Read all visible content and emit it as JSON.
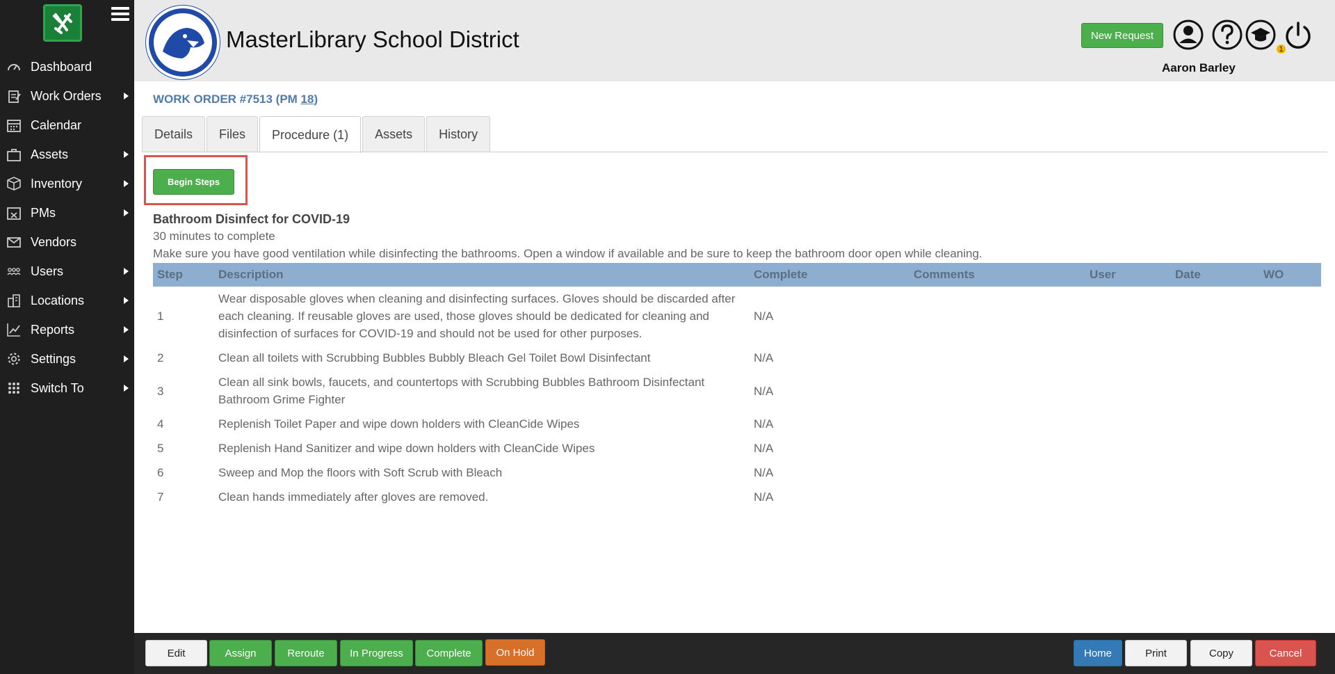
{
  "sidebar": {
    "items": [
      {
        "label": "Dashboard",
        "icon": "speedometer-icon",
        "has_arrow": false
      },
      {
        "label": "Work Orders",
        "icon": "clipboard-icon",
        "has_arrow": true
      },
      {
        "label": "Calendar",
        "icon": "calendar-icon",
        "has_arrow": false
      },
      {
        "label": "Assets",
        "icon": "briefcase-icon",
        "has_arrow": true
      },
      {
        "label": "Inventory",
        "icon": "box-icon",
        "has_arrow": true
      },
      {
        "label": "PMs",
        "icon": "tools-calendar-icon",
        "has_arrow": true
      },
      {
        "label": "Vendors",
        "icon": "envelope-icon",
        "has_arrow": false
      },
      {
        "label": "Users",
        "icon": "users-icon",
        "has_arrow": true
      },
      {
        "label": "Locations",
        "icon": "building-icon",
        "has_arrow": true
      },
      {
        "label": "Reports",
        "icon": "chart-line-icon",
        "has_arrow": true
      },
      {
        "label": "Settings",
        "icon": "gear-icon",
        "has_arrow": true
      },
      {
        "label": "Switch To",
        "icon": "grid-icon",
        "has_arrow": true
      }
    ]
  },
  "header": {
    "district_name": "MasterLibrary School District",
    "new_request_label": "New Request",
    "user_name": "Aaron Barley",
    "notification_count": "1"
  },
  "work_order": {
    "title_prefix": "WORK ORDER #7513 (PM ",
    "pm_number": "18",
    "title_suffix": ")"
  },
  "tabs": [
    {
      "label": "Details",
      "active": false
    },
    {
      "label": "Files",
      "active": false
    },
    {
      "label": "Procedure (1)",
      "active": true
    },
    {
      "label": "Assets",
      "active": false
    },
    {
      "label": "History",
      "active": false
    }
  ],
  "procedure": {
    "begin_steps_label": "Begin Steps",
    "title": "Bathroom Disinfect for COVID-19",
    "duration": "30 minutes to complete",
    "description": "Make sure you have good ventilation while disinfecting the bathrooms. Open a window if available and be sure to keep the bathroom door open while cleaning.",
    "columns": [
      "Step",
      "Description",
      "Complete",
      "Comments",
      "User",
      "Date",
      "WO"
    ],
    "steps": [
      {
        "step": "1",
        "description": "Wear disposable gloves when cleaning and disinfecting surfaces. Gloves should be discarded after each cleaning. If reusable gloves are used, those gloves should be dedicated for cleaning and disinfection of surfaces for COVID-19 and should not be used for other purposes.",
        "complete": "N/A"
      },
      {
        "step": "2",
        "description": "Clean all toilets with Scrubbing Bubbles Bubbly Bleach Gel Toilet Bowl Disinfectant",
        "complete": "N/A"
      },
      {
        "step": "3",
        "description": "Clean all sink bowls, faucets, and countertops with Scrubbing Bubbles Bathroom Disinfectant Bathroom Grime Fighter",
        "complete": "N/A"
      },
      {
        "step": "4",
        "description": "Replenish Toilet Paper and wipe down holders with CleanCide Wipes",
        "complete": "N/A"
      },
      {
        "step": "5",
        "description": "Replenish Hand Sanitizer and wipe down holders with CleanCide Wipes",
        "complete": "N/A"
      },
      {
        "step": "6",
        "description": "Sweep and Mop the floors with Soft Scrub with Bleach",
        "complete": "N/A"
      },
      {
        "step": "7",
        "description": "Clean hands immediately after gloves are removed.",
        "complete": "N/A"
      }
    ]
  },
  "footer": {
    "left_buttons": [
      {
        "label": "Edit",
        "style": "light"
      },
      {
        "label": "Assign",
        "style": "green"
      },
      {
        "label": "Reroute",
        "style": "green"
      },
      {
        "label": "In Progress",
        "style": "green"
      },
      {
        "label": "Complete",
        "style": "green"
      },
      {
        "label": "On Hold",
        "style": "orange"
      }
    ],
    "right_buttons": [
      {
        "label": "Home",
        "style": "blue"
      },
      {
        "label": "Print",
        "style": "light"
      },
      {
        "label": "Copy",
        "style": "light"
      },
      {
        "label": "Cancel",
        "style": "red"
      }
    ]
  },
  "colors": {
    "sidebar_bg": "#1f1f1f",
    "header_bg": "#e9e9e9",
    "accent_green": "#4cae4c",
    "title_blue": "#4f7cab",
    "table_header": "#8eaecf",
    "highlight_red": "#d9534f"
  }
}
